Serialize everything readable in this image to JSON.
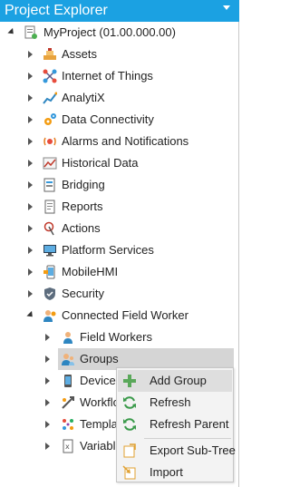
{
  "panel": {
    "title": "Project Explorer"
  },
  "tree": {
    "root": {
      "label": "MyProject (01.00.000.00)"
    },
    "items": [
      {
        "label": "Assets",
        "icon": "assets-icon"
      },
      {
        "label": "Internet of Things",
        "icon": "iot-icon"
      },
      {
        "label": "AnalytiX",
        "icon": "analytix-icon"
      },
      {
        "label": "Data Connectivity",
        "icon": "data-connectivity-icon"
      },
      {
        "label": "Alarms and Notifications",
        "icon": "alarms-icon"
      },
      {
        "label": "Historical Data",
        "icon": "historical-data-icon"
      },
      {
        "label": "Bridging",
        "icon": "bridging-icon"
      },
      {
        "label": "Reports",
        "icon": "reports-icon"
      },
      {
        "label": "Actions",
        "icon": "actions-icon"
      },
      {
        "label": "Platform Services",
        "icon": "platform-services-icon"
      },
      {
        "label": "MobileHMI",
        "icon": "mobilehmi-icon"
      },
      {
        "label": "Security",
        "icon": "security-icon"
      },
      {
        "label": "Connected Field Worker",
        "icon": "field-worker-icon"
      }
    ],
    "children": [
      {
        "label": "Field Workers",
        "icon": "field-workers-icon"
      },
      {
        "label": "Groups",
        "icon": "groups-icon"
      },
      {
        "label": "Device I",
        "icon": "device-icon"
      },
      {
        "label": "Workflo",
        "icon": "workflow-icon"
      },
      {
        "label": "Templat",
        "icon": "templates-icon"
      },
      {
        "label": "Variable",
        "icon": "variables-icon"
      }
    ]
  },
  "context_menu": {
    "items": [
      {
        "label": "Add Group",
        "icon": "plus-icon"
      },
      {
        "label": "Refresh",
        "icon": "refresh-icon"
      },
      {
        "label": "Refresh Parent",
        "icon": "refresh-icon"
      },
      {
        "label": "Export Sub-Tree",
        "icon": "export-icon"
      },
      {
        "label": "Import",
        "icon": "import-icon"
      }
    ]
  }
}
